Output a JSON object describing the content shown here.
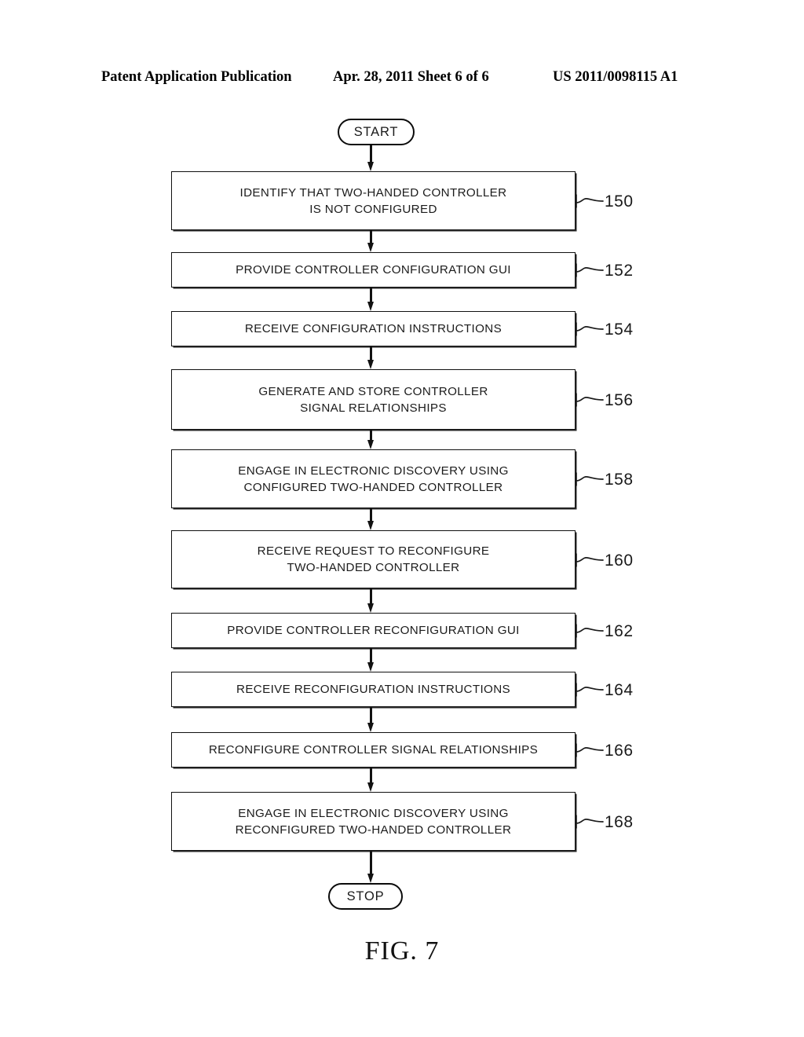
{
  "header": {
    "publication": "Patent Application Publication",
    "date_sheet": "Apr. 28, 2011  Sheet 6 of 6",
    "patent_number": "US 2011/0098115 A1"
  },
  "figure": {
    "caption": "FIG. 7"
  },
  "flowchart": {
    "start_label": "START",
    "stop_label": "STOP",
    "steps": [
      {
        "ref": "150",
        "text": "IDENTIFY THAT TWO-HANDED CONTROLLER\nIS NOT CONFIGURED"
      },
      {
        "ref": "152",
        "text": "PROVIDE CONTROLLER CONFIGURATION GUI"
      },
      {
        "ref": "154",
        "text": "RECEIVE CONFIGURATION INSTRUCTIONS"
      },
      {
        "ref": "156",
        "text": "GENERATE AND STORE CONTROLLER\nSIGNAL RELATIONSHIPS"
      },
      {
        "ref": "158",
        "text": "ENGAGE IN ELECTRONIC DISCOVERY USING\nCONFIGURED TWO-HANDED CONTROLLER"
      },
      {
        "ref": "160",
        "text": "RECEIVE REQUEST TO RECONFIGURE\nTWO-HANDED CONTROLLER"
      },
      {
        "ref": "162",
        "text": "PROVIDE CONTROLLER RECONFIGURATION GUI"
      },
      {
        "ref": "164",
        "text": "RECEIVE RECONFIGURATION INSTRUCTIONS"
      },
      {
        "ref": "166",
        "text": "RECONFIGURE CONTROLLER SIGNAL RELATIONSHIPS"
      },
      {
        "ref": "168",
        "text": "ENGAGE IN ELECTRONIC DISCOVERY USING\nRECONFIGURED TWO-HANDED CONTROLLER"
      }
    ]
  }
}
